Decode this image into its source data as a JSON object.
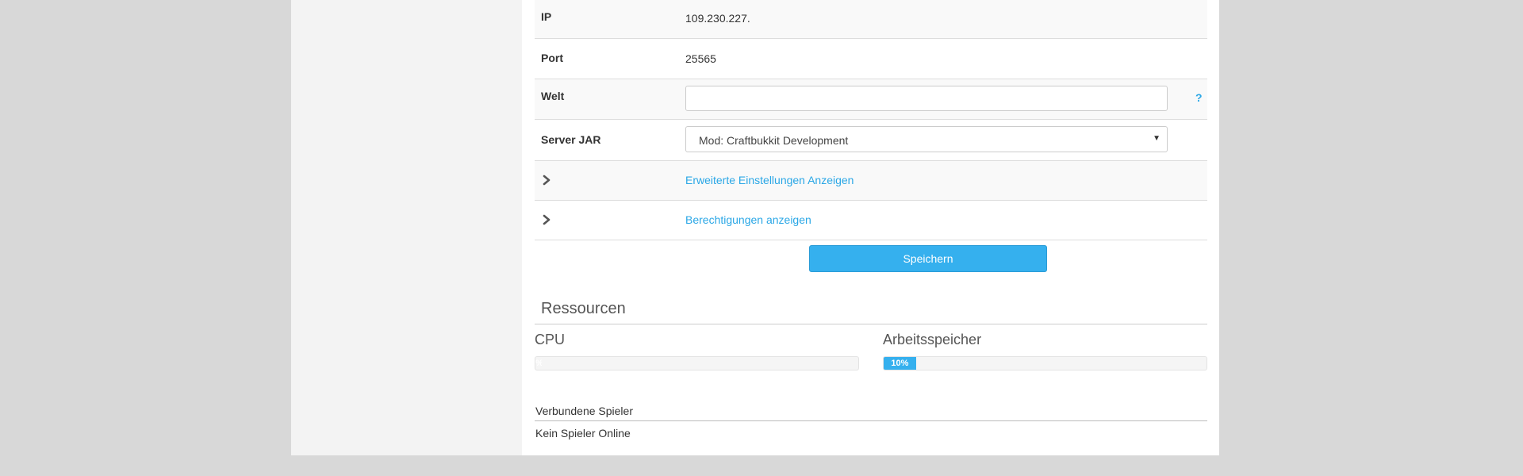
{
  "settings": {
    "ip_label": "IP",
    "ip_value": "109.230.227.",
    "port_label": "Port",
    "port_value": "25565",
    "world_label": "Welt",
    "world_value": "",
    "help_icon": "?",
    "jar_label": "Server JAR",
    "jar_selected": "Mod: Craftbukkit Development",
    "advanced_link": "Erweiterte Einstellungen Anzeigen",
    "permissions_link": "Berechtigungen anzeigen",
    "save_label": "Speichern"
  },
  "resources": {
    "title": "Ressourcen",
    "cpu_label": "CPU",
    "cpu_percent": 0,
    "cpu_text": "%",
    "memory_label": "Arbeitsspeicher",
    "memory_percent": 10,
    "memory_text": "10%"
  },
  "players": {
    "title": "Verbundene Spieler",
    "empty_text": "Kein Spieler Online"
  },
  "colors": {
    "accent": "#35b0ee",
    "link": "#2aa7e6",
    "background": "#d8d8d8"
  }
}
